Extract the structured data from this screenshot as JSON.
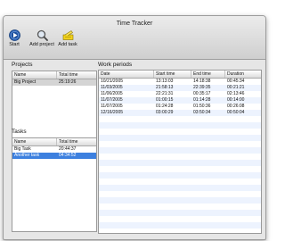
{
  "window": {
    "title": "Time Tracker"
  },
  "toolbar": {
    "start_label": "Start",
    "add_project_label": "Add project",
    "add_task_label": "Add task"
  },
  "projects": {
    "label": "Projects",
    "columns": [
      "Name",
      "Total time"
    ],
    "rows": [
      {
        "name": "Big Project",
        "total": "25:19:26"
      }
    ]
  },
  "tasks": {
    "label": "Tasks",
    "columns": [
      "Name",
      "Total time"
    ],
    "rows": [
      {
        "name": "Big Task",
        "total": "20:44:37"
      },
      {
        "name": "Another task",
        "total": "04:34:52"
      }
    ]
  },
  "work_periods": {
    "label": "Work periods",
    "columns": [
      "Date",
      "Start time",
      "End time",
      "Duration"
    ],
    "rows": [
      {
        "date": "10/21/2005",
        "start": "13:13:03",
        "end": "14:18:38",
        "duration": "00:45:34"
      },
      {
        "date": "11/03/2005",
        "start": "21:58:13",
        "end": "22:39:35",
        "duration": "00:21:21"
      },
      {
        "date": "11/06/2005",
        "start": "22:21:31",
        "end": "00:35:17",
        "duration": "02:13:46"
      },
      {
        "date": "11/07/2005",
        "start": "01:00:15",
        "end": "01:14:28",
        "duration": "00:14:00"
      },
      {
        "date": "11/07/2005",
        "start": "01:24:28",
        "end": "01:50:36",
        "duration": "00:26:08"
      },
      {
        "date": "12/16/2005",
        "start": "03:00:29",
        "end": "03:50:34",
        "duration": "00:50:04"
      }
    ]
  },
  "colors": {
    "stripe": "#edf3fe",
    "selection": "#3d80df",
    "inactive_selection": "#d4d4d4"
  },
  "icons": [
    "start-icon",
    "add-project-icon",
    "add-task-icon"
  ]
}
